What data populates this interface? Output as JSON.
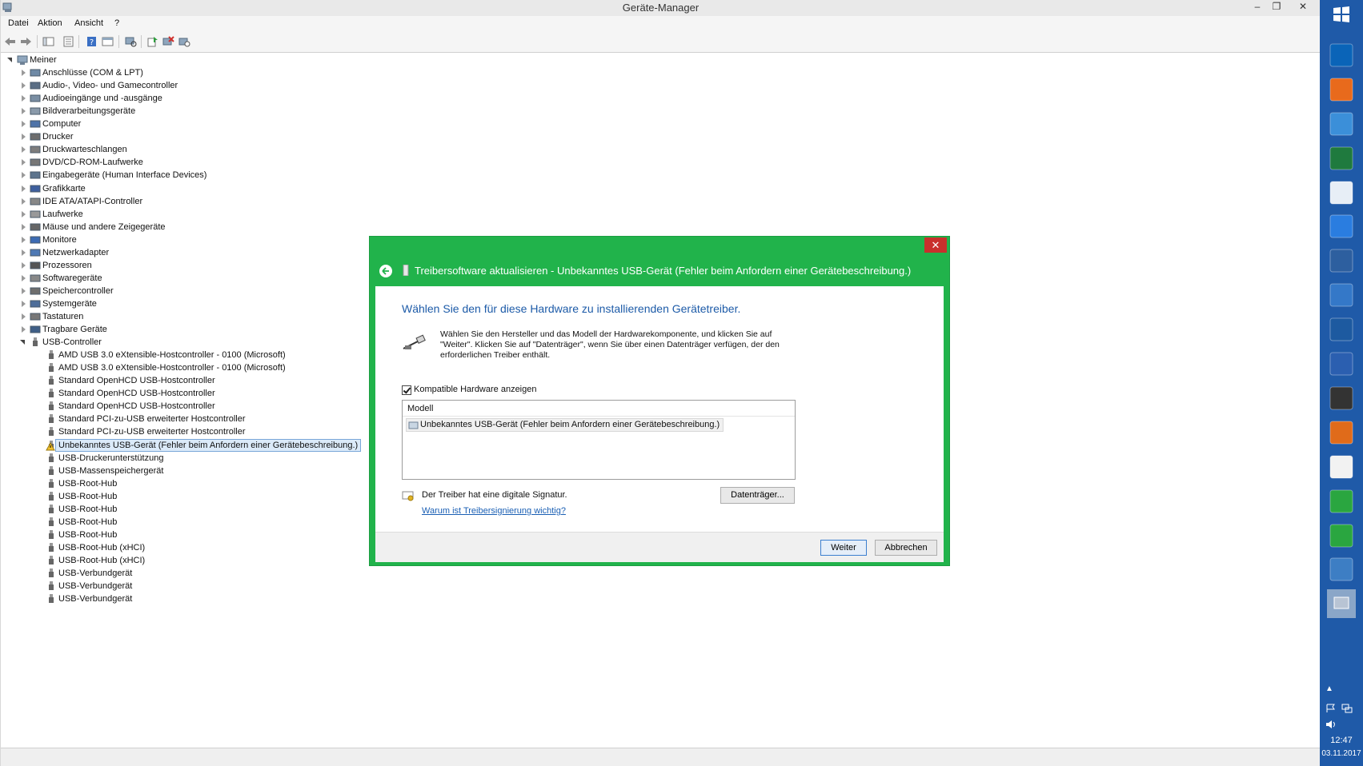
{
  "window": {
    "title": "Geräte-Manager",
    "min_glyph": "–",
    "max_glyph": "❐",
    "close_glyph": "✕"
  },
  "menu": [
    "Datei",
    "Aktion",
    "Ansicht",
    "?"
  ],
  "tree": {
    "root": "Meiner",
    "categories": [
      "Anschlüsse (COM & LPT)",
      "Audio-, Video- und Gamecontroller",
      "Audioeingänge und -ausgänge",
      "Bildverarbeitungsgeräte",
      "Computer",
      "Drucker",
      "Druckwarteschlangen",
      "DVD/CD-ROM-Laufwerke",
      "Eingabegeräte (Human Interface Devices)",
      "Grafikkarte",
      "IDE ATA/ATAPI-Controller",
      "Laufwerke",
      "Mäuse und andere Zeigegeräte",
      "Monitore",
      "Netzwerkadapter",
      "Prozessoren",
      "Softwaregeräte",
      "Speichercontroller",
      "Systemgeräte",
      "Tastaturen",
      "Tragbare Geräte"
    ],
    "usb_category": "USB-Controller",
    "usb_children": [
      "AMD USB 3.0 eXtensible-Hostcontroller - 0100 (Microsoft)",
      "AMD USB 3.0 eXtensible-Hostcontroller - 0100 (Microsoft)",
      "Standard OpenHCD USB-Hostcontroller",
      "Standard OpenHCD USB-Hostcontroller",
      "Standard OpenHCD USB-Hostcontroller",
      "Standard PCI-zu-USB erweiterter Hostcontroller",
      "Standard PCI-zu-USB erweiterter Hostcontroller",
      "Unbekanntes USB-Gerät (Fehler beim Anfordern einer Gerätebeschreibung.)",
      "USB-Druckerunterstützung",
      "USB-Massenspeichergerät",
      "USB-Root-Hub",
      "USB-Root-Hub",
      "USB-Root-Hub",
      "USB-Root-Hub",
      "USB-Root-Hub",
      "USB-Root-Hub (xHCI)",
      "USB-Root-Hub (xHCI)",
      "USB-Verbundgerät",
      "USB-Verbundgerät",
      "USB-Verbundgerät"
    ],
    "selected_index": 7
  },
  "dialog": {
    "close_glyph": "✕",
    "title": "Treibersoftware aktualisieren - Unbekanntes USB-Gerät (Fehler beim Anfordern einer Gerätebeschreibung.)",
    "heading": "Wählen Sie den für diese Hardware zu installierenden Gerätetreiber.",
    "description": "Wählen Sie den Hersteller und das Modell der Hardwarekomponente, und klicken Sie auf \"Weiter\". Klicken Sie auf \"Datenträger\", wenn Sie über einen Datenträger verfügen, der den erforderlichen Treiber enthält.",
    "checkbox_label": "Kompatible Hardware anzeigen",
    "checkbox_checked": true,
    "list_header": "Modell",
    "list_item": "Unbekanntes USB-Gerät (Fehler beim Anfordern einer Gerätebeschreibung.)",
    "signature_text": "Der Treiber hat eine digitale Signatur.",
    "signature_link": "Warum ist Treibersignierung wichtig?",
    "disk_button": "Datenträger...",
    "next_button": "Weiter",
    "cancel_button": "Abbrechen",
    "accent_color": "#21b34b"
  },
  "taskbar": {
    "apps": [
      "windows-logo-icon",
      "outlook-icon",
      "firefox-icon",
      "puzzle-app-icon",
      "excel-icon",
      "calculator-icon",
      "sun-app-icon",
      "cube-app-icon",
      "wave-app-icon",
      "teamviewer-icon",
      "word-icon",
      "calendar-14-icon",
      "media-player-icon",
      "list-app-icon",
      "green-chart-icon",
      "table-app-icon",
      "remote-desktop-icon",
      "device-manager-icon"
    ],
    "time": "12:47",
    "date": "03.11.2017",
    "color": "#1f5aa8"
  }
}
